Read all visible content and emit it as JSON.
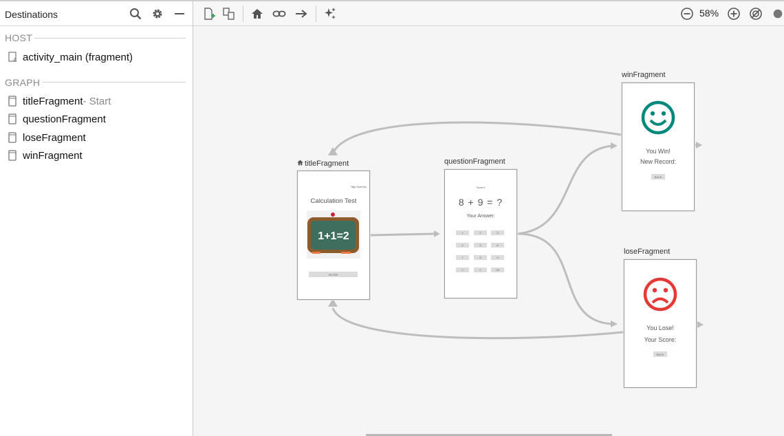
{
  "sidebar": {
    "title": "Destinations",
    "host_section": "HOST",
    "host_items": [
      {
        "label": "activity_main (fragment)"
      }
    ],
    "graph_section": "GRAPH",
    "graph_items": [
      {
        "label": "titleFragment",
        "suffix": " - Start"
      },
      {
        "label": "questionFragment"
      },
      {
        "label": "loseFragment"
      },
      {
        "label": "winFragment"
      }
    ]
  },
  "toolbar": {
    "zoom": "58%"
  },
  "graph": {
    "title_fragment": {
      "label": "titleFragment",
      "high_score": "High Score:No",
      "heading": "Calculation Test",
      "board_text": "1+1=2",
      "button": "ENTER"
    },
    "question_fragment": {
      "label": "questionFragment",
      "score": "Score:0",
      "equation": "8 + 9 = ?",
      "answer_label": "Your Answer:",
      "keys": [
        "1",
        "2",
        "3",
        "4",
        "5",
        "6",
        "7",
        "8",
        "9",
        "C",
        "0",
        "OK"
      ]
    },
    "win_fragment": {
      "label": "winFragment",
      "line1": "You Win!",
      "line2": "New Record:",
      "button": "BACK",
      "face_color": "#00897b"
    },
    "lose_fragment": {
      "label": "loseFragment",
      "line1": "You Lose!",
      "line2": "Your Score:",
      "button": "BACK",
      "face_color": "#e53935"
    }
  }
}
